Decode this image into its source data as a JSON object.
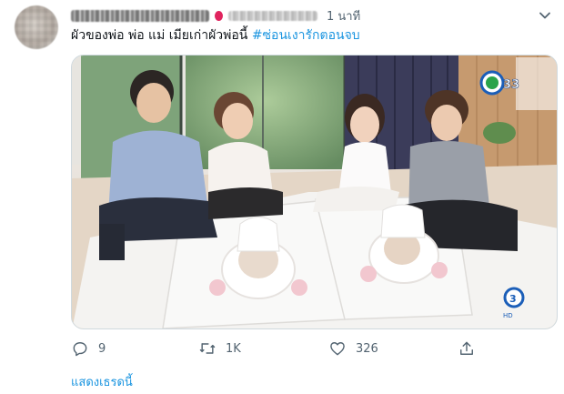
{
  "tweet": {
    "author_name": "",
    "author_handle": "",
    "time": "1 นาที",
    "text": "ผัวของพ่อ พ่อ แม่ เมียเก่าผัวพ่อนี้",
    "hashtag": "#ซ่อนเงารักตอนจบ",
    "media": {
      "channel_logo_top": "33",
      "channel_logo_bottom": "3",
      "channel_logo_bottom_sub": "HD"
    }
  },
  "actions": {
    "reply_count": "9",
    "retweet_count": "1K",
    "like_count": "326"
  },
  "show_thread_label": "แสดงเธรดนี้",
  "icons": {
    "more": "chevron-down-icon",
    "reply": "reply-icon",
    "retweet": "retweet-icon",
    "like": "heart-icon",
    "share": "share-icon"
  },
  "colors": {
    "accent": "#1b95e0",
    "muted": "#536471"
  }
}
